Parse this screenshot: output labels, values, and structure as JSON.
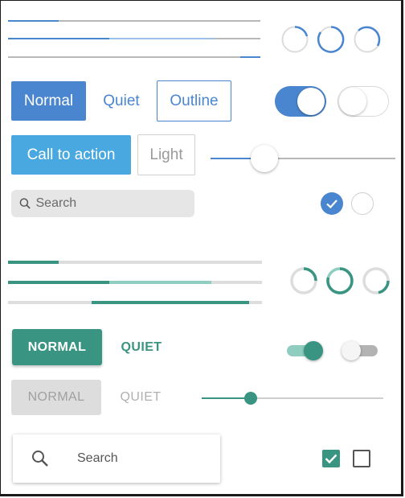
{
  "blue_theme": {
    "progress_bars": [
      {
        "value": 0.2
      },
      {
        "value": 0.4,
        "buffer": 0.82
      },
      {
        "start": 0.92,
        "end": 1.0
      }
    ],
    "spinners": [
      "spinner",
      "spinner",
      "spinner"
    ],
    "buttons": {
      "normal": "Normal",
      "quiet": "Quiet",
      "outline": "Outline",
      "call_to_action": "Call to action",
      "light": "Light"
    },
    "toggles": {
      "first_on": true,
      "second_on": false
    },
    "slider": {
      "value": 0.29
    },
    "search": {
      "placeholder": "Search",
      "icon": "search-icon"
    },
    "checkboxes": {
      "first_checked": true,
      "second_checked": false
    },
    "colors": {
      "accent": "#4a86cf",
      "cta": "#4aa8e0"
    }
  },
  "teal_theme": {
    "progress_bars": [
      {
        "value": 0.2
      },
      {
        "value": 0.4,
        "buffer": 0.8
      },
      {
        "start": 0.33,
        "end": 0.95
      }
    ],
    "spinners": [
      "spinner",
      "spinner",
      "spinner"
    ],
    "buttons": {
      "normal": "NORMAL",
      "quiet": "QUIET",
      "normal_disabled": "NORMAL",
      "quiet_disabled": "QUIET"
    },
    "toggles": {
      "first_on": true,
      "second_on": false
    },
    "slider": {
      "value": 0.27
    },
    "search": {
      "placeholder": "Search",
      "icon": "search-icon"
    },
    "checkboxes": {
      "first_checked": true,
      "second_checked": false
    },
    "colors": {
      "accent": "#3a9482",
      "accent_light": "#8fcdc1"
    }
  }
}
